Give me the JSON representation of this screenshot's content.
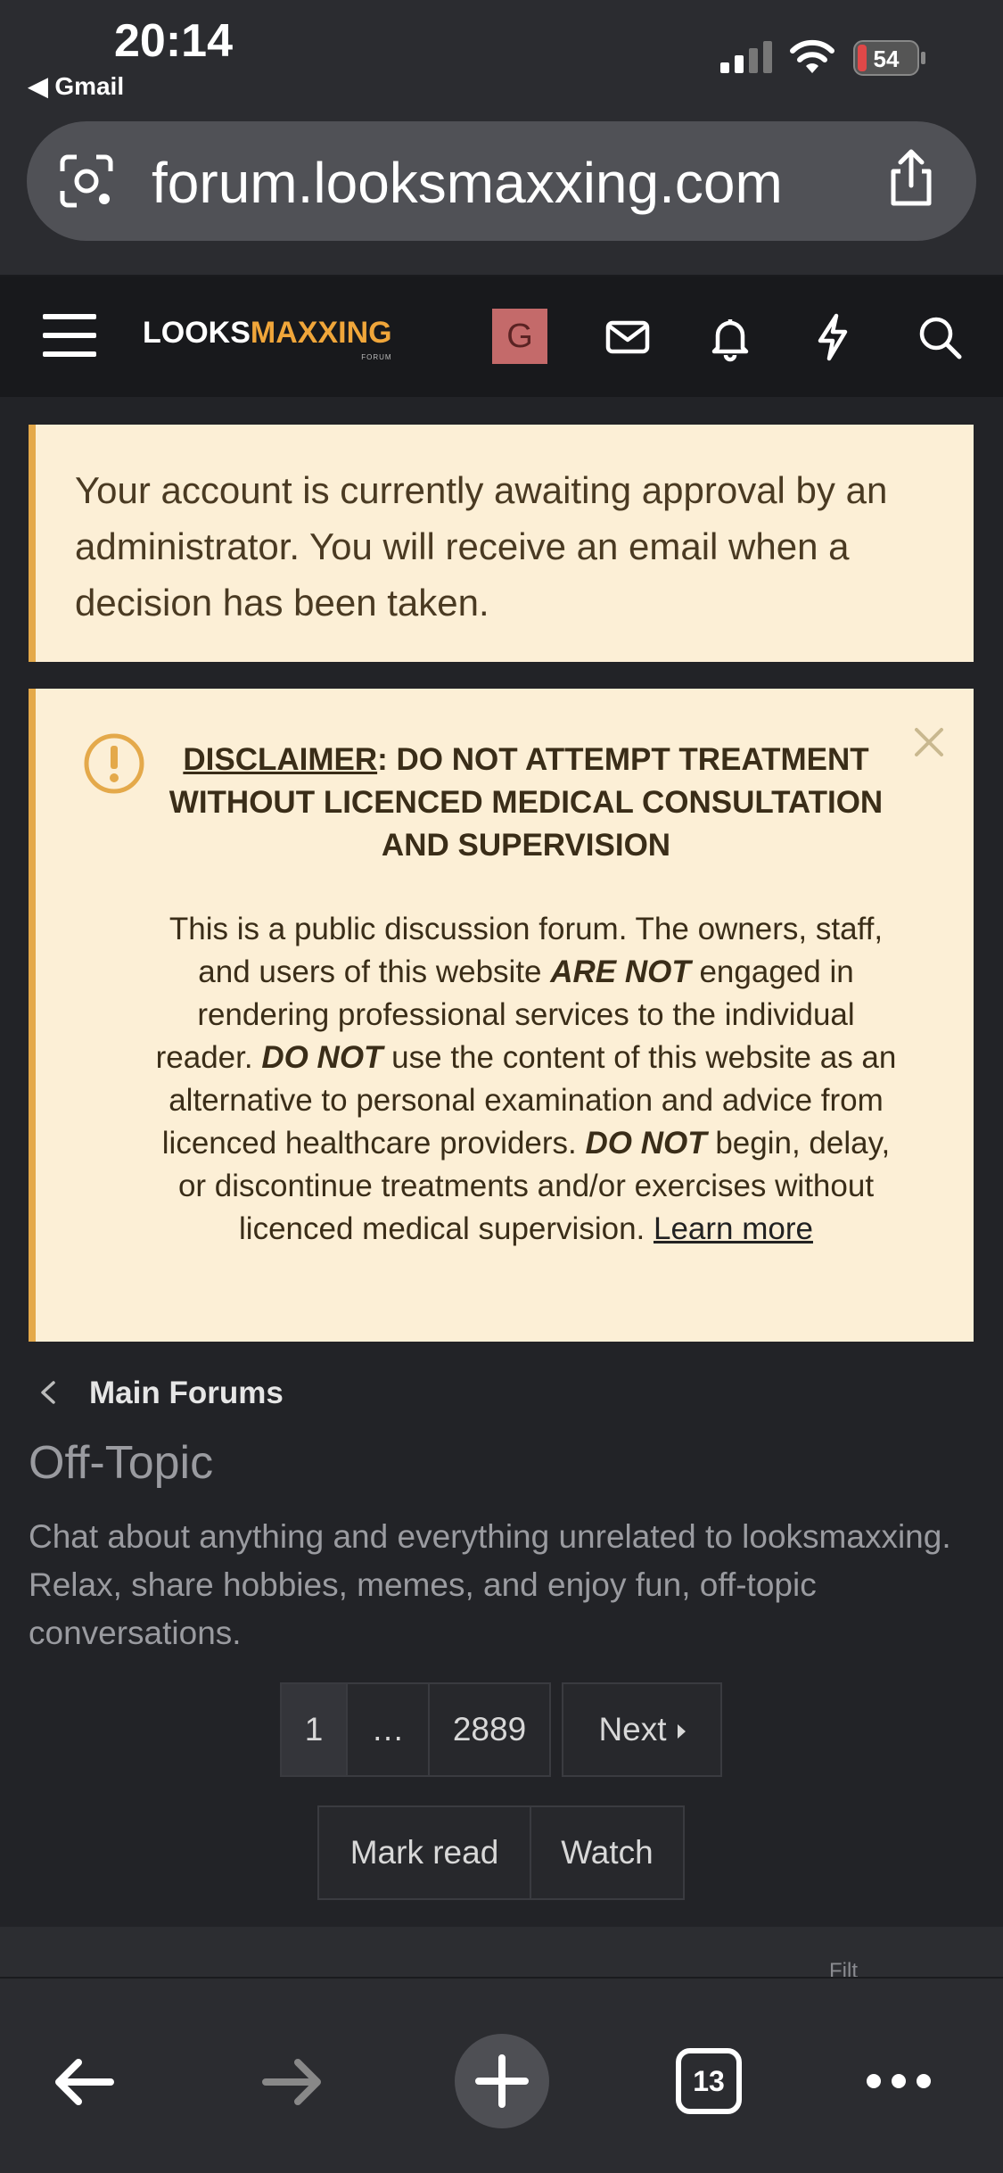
{
  "status_bar": {
    "time": "20:14",
    "back_app": "◀ Gmail",
    "battery": "54"
  },
  "browser": {
    "url": "forum.looksmaxxing.com"
  },
  "header": {
    "logo_main_1": "LOOKS",
    "logo_main_2": "MAXXING",
    "logo_sub": "FORUM",
    "avatar_letter": "G",
    "accent_color": "#f0a63a",
    "avatar_color": "#c46a6a",
    "icons": [
      "menu-icon",
      "mail-icon",
      "bell-icon",
      "lightning-icon",
      "search-icon"
    ]
  },
  "notices": {
    "approval": "Your account is currently awaiting approval by an administrator. You will receive an email when a decision has been taken.",
    "disclaimer_title_label": "DISCLAIMER",
    "disclaimer_title_rest": ": DO NOT ATTEMPT TREATMENT WITHOUT LICENCED MEDICAL CONSULTATION AND SUPERVISION",
    "body_1": "This is a public discussion forum. The owners, staff, and users of this website ",
    "body_2": "ARE NOT",
    "body_3": " engaged in rendering professional services to the individual reader. ",
    "body_4": "DO NOT",
    "body_5": " use the content of this website as an alternative to personal examination and advice from licenced healthcare providers. ",
    "body_6": "DO NOT",
    "body_7": " begin, delay, or discontinue treatments and/or exercises without licenced medical supervision. ",
    "learn_more": "Learn more"
  },
  "breadcrumb": {
    "label": "Main Forums"
  },
  "forum": {
    "title": "Off-Topic",
    "description": "Chat about anything and everything unrelated to looksmaxxing. Relax, share hobbies, memes, and enjoy fun, off-topic conversations."
  },
  "pagination": {
    "current": "1",
    "ellipsis": "…",
    "last": "2889",
    "next": "Next"
  },
  "actions": {
    "mark_read": "Mark read",
    "watch": "Watch"
  },
  "peek": {
    "filters": "Filt"
  },
  "toolbar": {
    "tabs_count": "13"
  }
}
